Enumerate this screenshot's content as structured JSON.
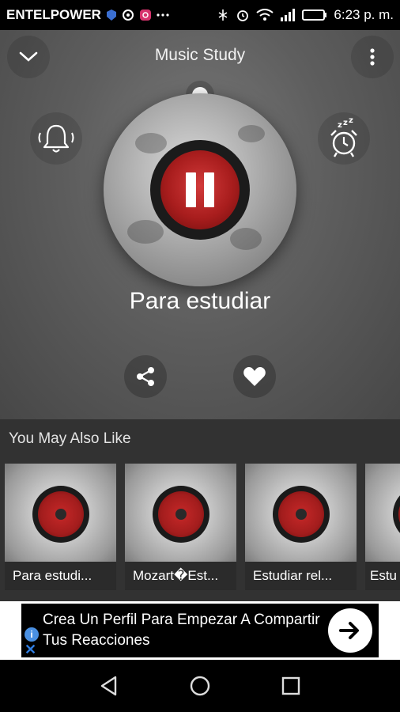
{
  "status_bar": {
    "carrier": "ENTELPOWER",
    "time": "6:23 p. m."
  },
  "header": {
    "title": "Music Study"
  },
  "player": {
    "track_name": "Para estudiar",
    "state": "playing"
  },
  "recommendations": {
    "heading": "You May Also Like",
    "items": [
      {
        "label": "Para estudi..."
      },
      {
        "label": "Mozart�Est..."
      },
      {
        "label": "Estudiar rel..."
      },
      {
        "label": "Estu"
      }
    ]
  },
  "ad": {
    "text": "Crea Un Perfil Para Empezar A Compartir Tus Reacciones",
    "info_glyph": "i",
    "close_glyph": "✕"
  },
  "colors": {
    "accent_red": "#b71c1c",
    "background_dark": "#323232"
  }
}
